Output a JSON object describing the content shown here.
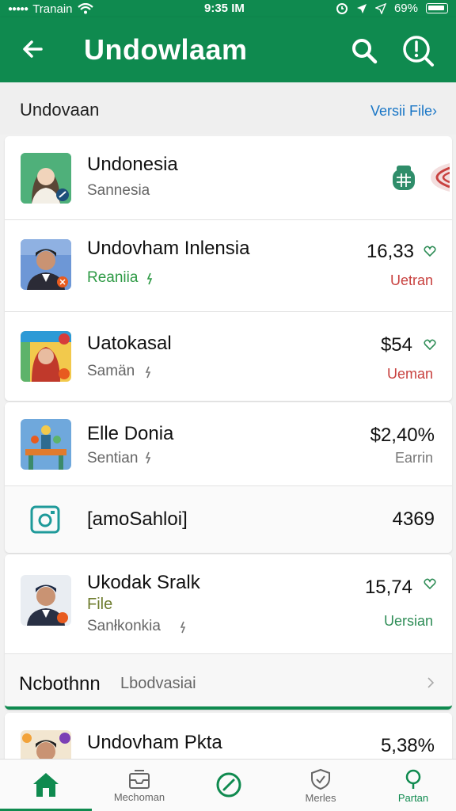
{
  "status_bar": {
    "carrier": "Tranain",
    "time": "9:35 IM",
    "battery": "69%"
  },
  "app_bar": {
    "title": "Undowlaam"
  },
  "section": {
    "label": "Undovaan",
    "link": "Versii File›"
  },
  "items": [
    {
      "name": "Undonesia",
      "sub": "Sannesia",
      "value": "",
      "status": ""
    },
    {
      "name": "Undovham Inlensia",
      "sub": "Reaniia",
      "value": "16,33",
      "status": "Uetran"
    },
    {
      "name": "Uatokasal",
      "sub": "Samän",
      "value": "$54",
      "status": "Ueman"
    },
    {
      "name": "Elle Donia",
      "sub": "Sentian",
      "value": "$2,40%",
      "status": "Earrin"
    },
    {
      "name": "[amoSahloi]",
      "sub": "",
      "value": "4369",
      "status": ""
    },
    {
      "name": "Ukodak Sralk",
      "extra": "File",
      "sub": "Sanłkonkia",
      "value": "15,74",
      "status": "Uersian"
    },
    {
      "name": "Ncbothnn",
      "sub": "Lbodvasiai",
      "value": "",
      "status": ""
    },
    {
      "name": "Undovham Pkta",
      "sub": "",
      "value": "5,38%",
      "status": ""
    }
  ],
  "bottom_nav": [
    {
      "label": "",
      "icon": "home-icon"
    },
    {
      "label": "Mechoman",
      "icon": "inbox-icon"
    },
    {
      "label": "",
      "icon": "compass-icon"
    },
    {
      "label": "Merles",
      "icon": "shield-icon"
    },
    {
      "label": "Partan",
      "icon": "location-icon"
    }
  ],
  "colors": {
    "primary": "#0f8a4f",
    "link": "#1976c6",
    "negative": "#c8413f",
    "positive": "#2f8d57"
  }
}
